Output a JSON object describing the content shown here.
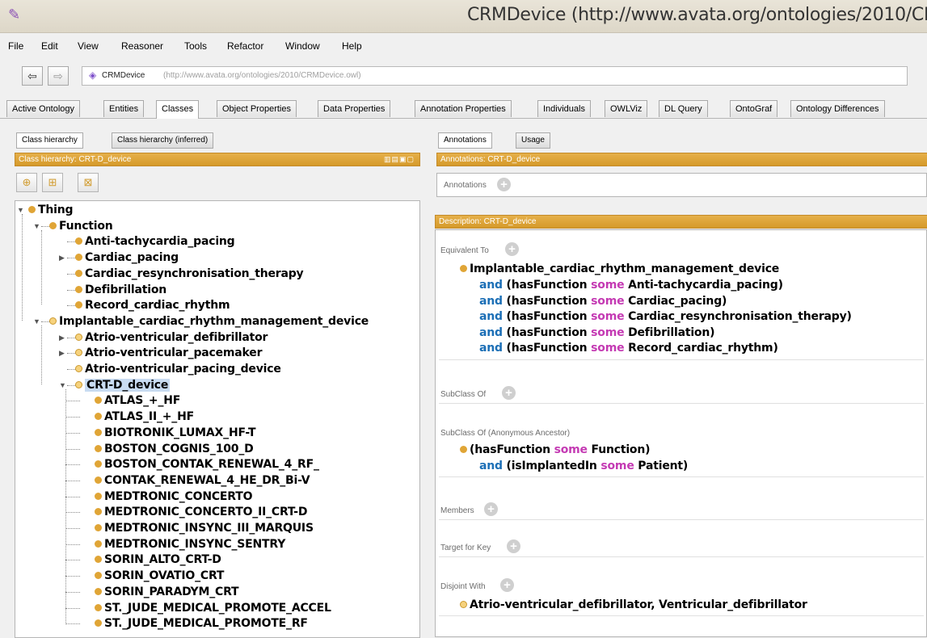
{
  "window": {
    "title": "CRMDevice (http://www.avata.org/ontologies/2010/CR",
    "icon": "protege-icon"
  },
  "menu": [
    "File",
    "Edit",
    "View",
    "Reasoner",
    "Tools",
    "Refactor",
    "Window",
    "Help"
  ],
  "nav": {
    "back": "⇦",
    "forward": "⇨",
    "ontology_name": "CRMDevice",
    "ontology_iri": "(http://www.avata.org/ontologies/2010/CRMDevice.owl)"
  },
  "tabs": [
    "Active Ontology",
    "Entities",
    "Classes",
    "Object Properties",
    "Data Properties",
    "Annotation Properties",
    "Individuals",
    "OWLViz",
    "DL Query",
    "OntoGraf",
    "Ontology Differences"
  ],
  "active_tab": "Classes",
  "left": {
    "subtabs": [
      "Class hierarchy",
      "Class hierarchy (inferred)"
    ],
    "header": "Class hierarchy: CRT-D_device",
    "header_icons": "▥▤▣▢",
    "tree": [
      {
        "label": "Thing",
        "level": 0,
        "expanded": true
      },
      {
        "label": "Function",
        "level": 1,
        "expanded": true
      },
      {
        "label": "Anti-tachycardia_pacing",
        "level": 2
      },
      {
        "label": "Cardiac_pacing",
        "level": 2,
        "collapsed": true
      },
      {
        "label": "Cardiac_resynchronisation_therapy",
        "level": 2
      },
      {
        "label": "Defibrillation",
        "level": 2
      },
      {
        "label": "Record_cardiac_rhythm",
        "level": 2
      },
      {
        "label": "Implantable_cardiac_rhythm_management_device",
        "level": 1,
        "expanded": true,
        "ring": true
      },
      {
        "label": "Atrio-ventricular_defibrillator",
        "level": 2,
        "collapsed": true,
        "ring": true
      },
      {
        "label": "Atrio-ventricular_pacemaker",
        "level": 2,
        "collapsed": true,
        "ring": true
      },
      {
        "label": "Atrio-ventricular_pacing_device",
        "level": 2,
        "ring": true
      },
      {
        "label": "CRT-D_device",
        "level": 2,
        "expanded": true,
        "ring": true,
        "selected": true
      },
      {
        "label": "ATLAS_+_HF",
        "level": 3
      },
      {
        "label": "ATLAS_II_+_HF",
        "level": 3
      },
      {
        "label": "BIOTRONIK_LUMAX_HF-T",
        "level": 3
      },
      {
        "label": "BOSTON_COGNIS_100_D",
        "level": 3
      },
      {
        "label": "BOSTON_CONTAK_RENEWAL_4_RF_",
        "level": 3
      },
      {
        "label": "CONTAK_RENEWAL_4_HE_DR_Bi-V",
        "level": 3
      },
      {
        "label": "MEDTRONIC_CONCERTO",
        "level": 3
      },
      {
        "label": "MEDTRONIC_CONCERTO_II_CRT-D",
        "level": 3
      },
      {
        "label": "MEDTRONIC_INSYNC_III_MARQUIS",
        "level": 3
      },
      {
        "label": "MEDTRONIC_INSYNC_SENTRY",
        "level": 3
      },
      {
        "label": "SORIN_ALTO_CRT-D",
        "level": 3
      },
      {
        "label": "SORIN_OVATIO_CRT",
        "level": 3
      },
      {
        "label": "SORIN_PARADYM_CRT",
        "level": 3
      },
      {
        "label": "ST._JUDE_MEDICAL_PROMOTE_ACCEL",
        "level": 3
      },
      {
        "label": "ST._JUDE_MEDICAL_PROMOTE_RF",
        "level": 3
      }
    ]
  },
  "right": {
    "subtabs": [
      "Annotations",
      "Usage"
    ],
    "annotations_header": "Annotations: CRT-D_device",
    "annotations_label": "Annotations",
    "description_header": "Description: CRT-D_device",
    "equivalent_label": "Equivalent To",
    "equivalent_class": "Implantable_cardiac_rhythm_management_device",
    "and_kw": "and",
    "some_kw": "some",
    "equivalent_restrictions": [
      {
        "prop": "(hasFunction",
        "filler": "Anti-tachycardia_pacing)"
      },
      {
        "prop": "(hasFunction",
        "filler": "Cardiac_pacing)"
      },
      {
        "prop": "(hasFunction",
        "filler": "Cardiac_resynchronisation_therapy)"
      },
      {
        "prop": "(hasFunction",
        "filler": "Defibrillation)"
      },
      {
        "prop": "(hasFunction",
        "filler": "Record_cardiac_rhythm)"
      }
    ],
    "subclass_label": "SubClass Of",
    "anon_label": "SubClass Of (Anonymous Ancestor)",
    "anon_line1_prop": "(hasFunction",
    "anon_line1_filler": "Function)",
    "anon_line2_prop": "(isImplantedIn",
    "anon_line2_filler": "Patient)",
    "members_label": "Members",
    "target_label": "Target for Key",
    "disjoint_label": "Disjoint With",
    "disjoint_value": "Atrio-ventricular_defibrillator, Ventricular_defibrillator"
  }
}
